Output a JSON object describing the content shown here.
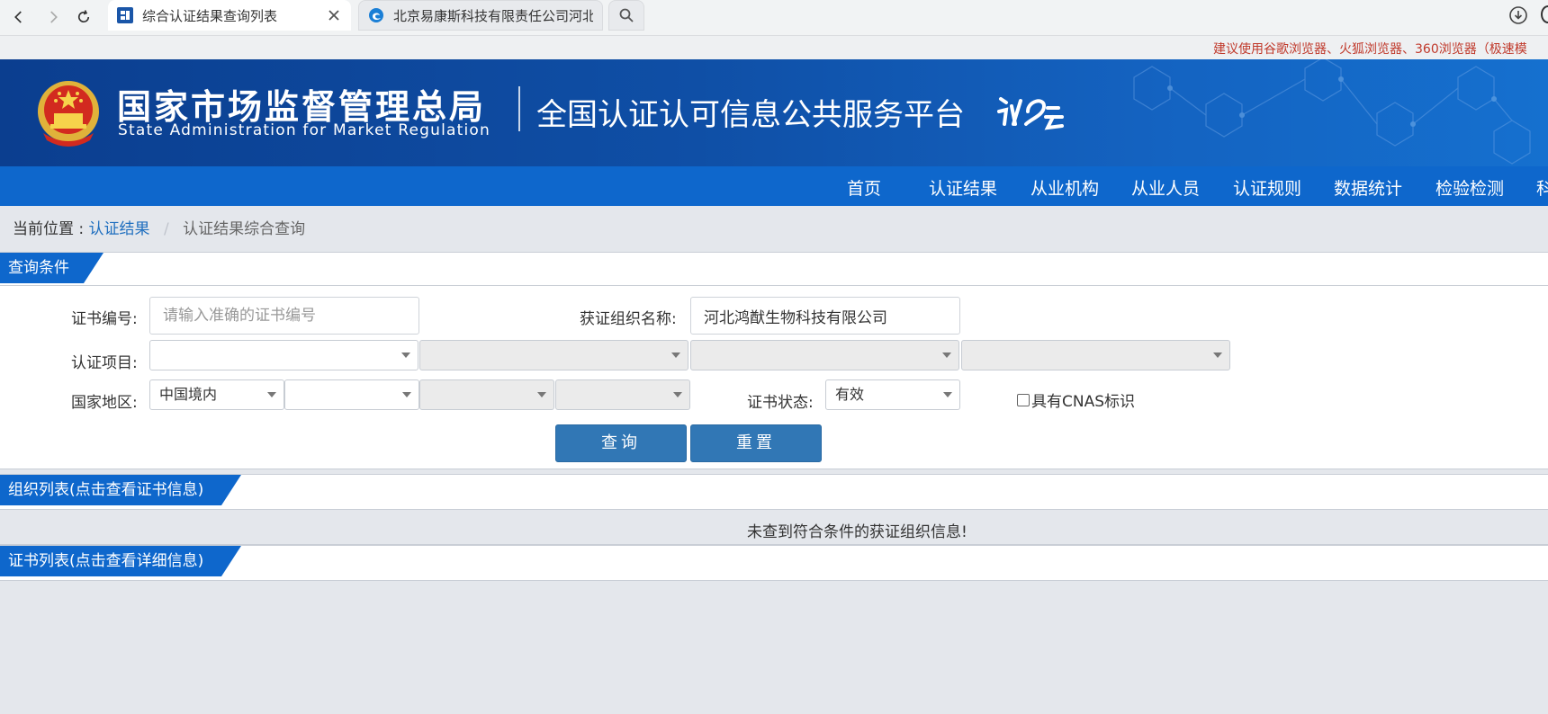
{
  "browser": {
    "tabs": [
      {
        "title": "综合认证结果查询列表",
        "active": true
      },
      {
        "title": "北京易康斯科技有限责任公司河北",
        "active": false
      }
    ]
  },
  "notice": "建议使用谷歌浏览器、火狐浏览器、360浏览器（极速模",
  "header": {
    "agency_cn": "国家市场监督管理总局",
    "agency_en": "State Administration  for  Market Regulation",
    "platform": "全国认证认可信息公共服务平台",
    "brand_color": "#0e67cc"
  },
  "nav": {
    "items": [
      "首页",
      "认证结果",
      "从业机构",
      "从业人员",
      "认证规则",
      "数据统计",
      "检验检测",
      "科"
    ]
  },
  "breadcrumb": {
    "prefix": "当前位置 :",
    "link": "认证结果",
    "separator": "/",
    "current": "认证结果综合查询"
  },
  "query": {
    "title": "查询条件",
    "cert_no_label": "证书编号:",
    "cert_no_placeholder": "请输入准确的证书编号",
    "org_name_label": "获证组织名称:",
    "org_name_value": "河北鸿猷生物科技有限公司",
    "project_label": "认证项目:",
    "region_label": "国家地区:",
    "region_value": "中国境内",
    "status_label": "证书状态:",
    "status_value": "有效",
    "cnas_label": "具有CNAS标识",
    "search_btn": "查询",
    "reset_btn": "重置"
  },
  "org_list": {
    "title": "组织列表(点击查看证书信息)",
    "empty_message": "未查到符合条件的获证组织信息!"
  },
  "cert_list": {
    "title": "证书列表(点击查看详细信息)"
  }
}
